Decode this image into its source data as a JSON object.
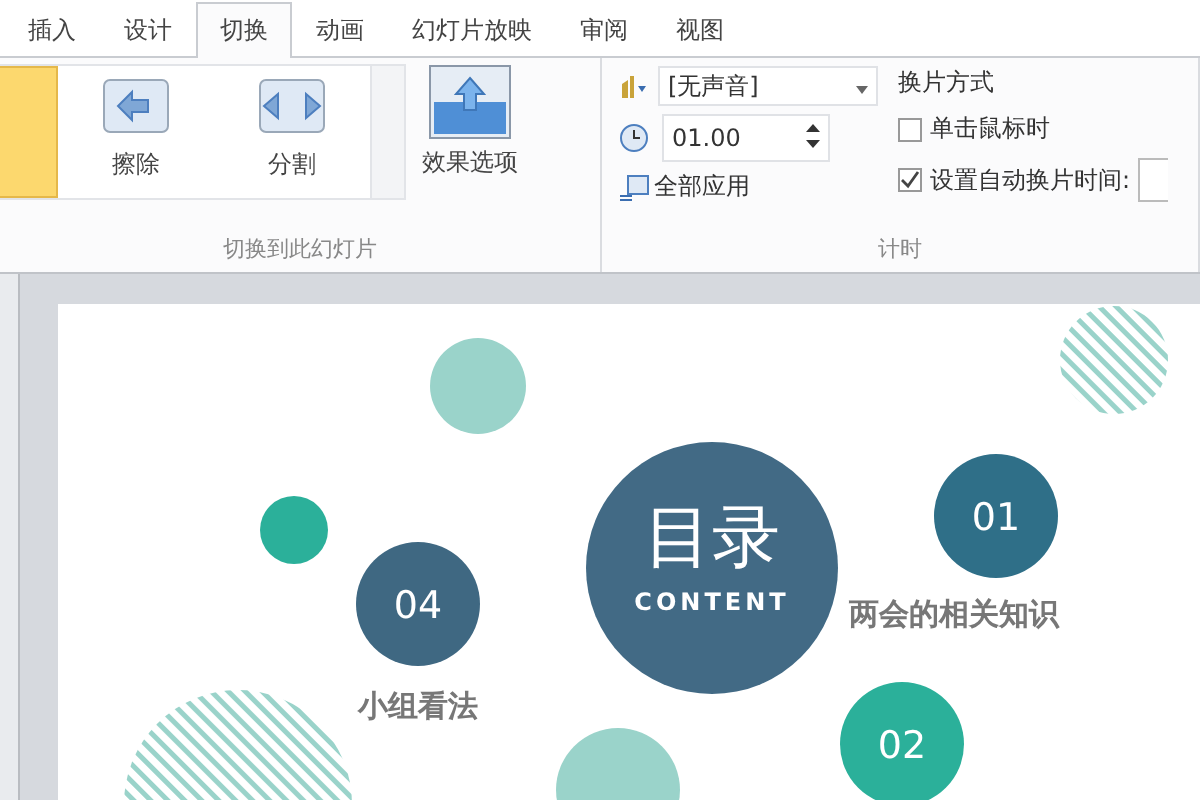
{
  "tabs": [
    {
      "label": "插入",
      "selected": false
    },
    {
      "label": "设计",
      "selected": false
    },
    {
      "label": "切换",
      "selected": true
    },
    {
      "label": "动画",
      "selected": false
    },
    {
      "label": "幻灯片放映",
      "selected": false
    },
    {
      "label": "审阅",
      "selected": false
    },
    {
      "label": "视图",
      "selected": false
    }
  ],
  "transitions_group": {
    "gallery": [
      {
        "selected": true
      },
      {
        "label": "擦除",
        "selected": false
      },
      {
        "label": "分割",
        "selected": false
      }
    ],
    "effect_options": "效果选项",
    "group_label": "切换到此幻灯片"
  },
  "timing_group": {
    "sound": "[无声音]",
    "duration": "01.00",
    "apply_all": "全部应用",
    "advance_title": "换片方式",
    "options": [
      {
        "label": "单击鼠标时",
        "checked": false
      },
      {
        "label": "设置自动换片时间:",
        "checked": true
      }
    ],
    "group_label": "计时"
  },
  "slide": {
    "title": "目录",
    "subtitle": "CONTENT",
    "items": [
      {
        "number": "01",
        "label": "两会的相关知识",
        "color": "#2f6f88"
      },
      {
        "number": "02",
        "color": "#2bb09a"
      },
      {
        "color": "#9ad3ca"
      },
      {
        "number": "04",
        "label": "小组看法",
        "color": "#3f6882"
      }
    ]
  }
}
